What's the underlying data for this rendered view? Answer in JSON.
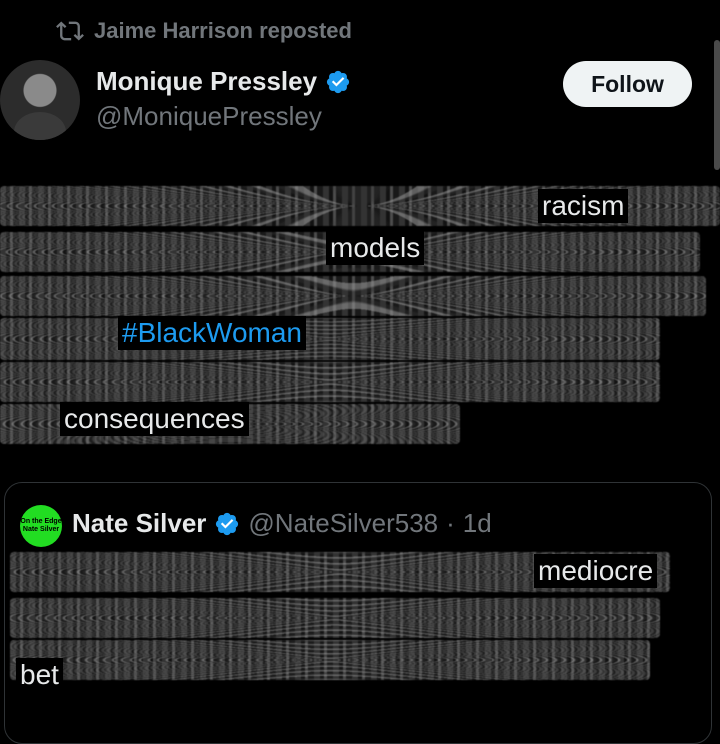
{
  "repost": {
    "icon": "repost-icon",
    "text": "Jaime Harrison reposted"
  },
  "author": {
    "avatar_icon": "avatar",
    "display_name": "Monique Pressley",
    "handle": "@MoniquePressley",
    "verified_icon": "verified-badge-icon",
    "follow_label": "Follow"
  },
  "post": {
    "visible_words": [
      "racism",
      "models",
      "#BlackWoman",
      "consequences"
    ]
  },
  "quote": {
    "avatar_text": "On the Edge Nate Silver",
    "display_name": "Nate Silver",
    "handle": "@NateSilver538",
    "separator": "·",
    "time": "1d",
    "visible_words": [
      "mediocre",
      "bet"
    ]
  },
  "colors": {
    "background": "#000000",
    "text": "#e7e9ea",
    "secondary": "#71767b",
    "link": "#1d9bf0",
    "verified": "#1d9bf0",
    "follow_bg": "#eff3f4"
  }
}
